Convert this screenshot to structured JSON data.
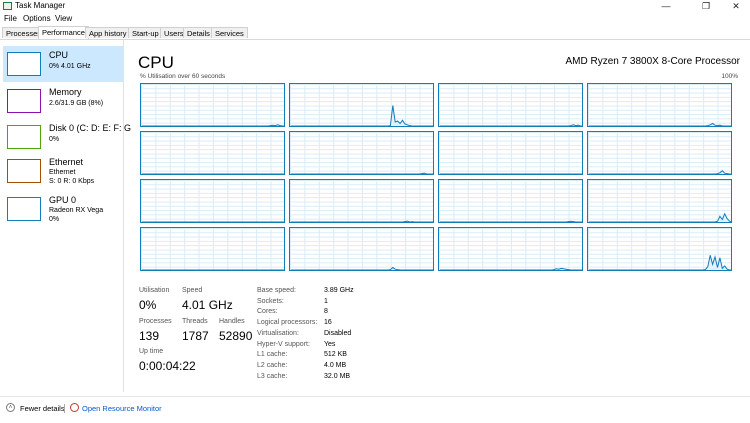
{
  "window": {
    "title": "Task Manager",
    "minimize": "—",
    "restore": "❐",
    "close": "✕"
  },
  "menu": [
    "File",
    "Options",
    "View"
  ],
  "tabs": [
    "Processes",
    "Performance",
    "App history",
    "Start-up",
    "Users",
    "Details",
    "Services"
  ],
  "active_tab": 1,
  "sidebar": [
    {
      "title": "CPU",
      "sub1": "0% 4.01 GHz",
      "sub2": "",
      "color": "#117dbb"
    },
    {
      "title": "Memory",
      "sub1": "2.6/31.9 GB (8%)",
      "sub2": "",
      "color": "#8b12ae"
    },
    {
      "title": "Disk 0 (C: D: E: F: G",
      "sub1": "0%",
      "sub2": "",
      "color": "#4da60c"
    },
    {
      "title": "Ethernet",
      "sub1": "Ethernet",
      "sub2": "S: 0 R: 0 Kbps",
      "color": "#a74f01"
    },
    {
      "title": "GPU 0",
      "sub1": "Radeon RX Vega",
      "sub2": "0%",
      "color": "#117dbb"
    }
  ],
  "main": {
    "title": "CPU",
    "processor": "AMD Ryzen 7 3800X 8-Core Processor",
    "util_label": "% Utilisation over 60 seconds",
    "util_max": "100%",
    "graph_color": "#117dbb"
  },
  "cores": [
    [
      0,
      0,
      0,
      0,
      0,
      0,
      0,
      0,
      0,
      0,
      0,
      0,
      0,
      0,
      0,
      0,
      0,
      0,
      0,
      0,
      0,
      0,
      0,
      0,
      0,
      0,
      0,
      0,
      0,
      0,
      0,
      0,
      0,
      0,
      0,
      0,
      0,
      0,
      0,
      0,
      0,
      0,
      0,
      0,
      0,
      0,
      0,
      0,
      0,
      0,
      0,
      0,
      0,
      1,
      2,
      1,
      3,
      1,
      0,
      0
    ],
    [
      0,
      0,
      0,
      0,
      0,
      0,
      0,
      0,
      0,
      0,
      0,
      0,
      0,
      0,
      0,
      0,
      0,
      0,
      0,
      0,
      0,
      0,
      0,
      0,
      0,
      0,
      0,
      0,
      0,
      0,
      0,
      0,
      0,
      0,
      0,
      0,
      0,
      0,
      0,
      0,
      0,
      1,
      50,
      10,
      12,
      6,
      14,
      5,
      3,
      1,
      0,
      0,
      0,
      0,
      0,
      0,
      0,
      0,
      0,
      0
    ],
    [
      0,
      0,
      0,
      0,
      0,
      0,
      0,
      0,
      0,
      0,
      0,
      0,
      0,
      0,
      0,
      0,
      0,
      0,
      0,
      0,
      0,
      0,
      0,
      0,
      0,
      0,
      0,
      0,
      0,
      0,
      0,
      0,
      0,
      0,
      0,
      0,
      0,
      0,
      0,
      0,
      0,
      0,
      0,
      0,
      0,
      0,
      0,
      0,
      0,
      0,
      0,
      0,
      0,
      0,
      1,
      3,
      1,
      2,
      0,
      0
    ],
    [
      0,
      0,
      0,
      0,
      0,
      0,
      0,
      0,
      0,
      0,
      0,
      0,
      0,
      0,
      0,
      0,
      0,
      0,
      0,
      0,
      0,
      0,
      0,
      0,
      0,
      0,
      0,
      0,
      0,
      0,
      0,
      0,
      0,
      0,
      0,
      0,
      0,
      0,
      0,
      0,
      0,
      0,
      0,
      0,
      0,
      0,
      0,
      0,
      0,
      1,
      3,
      6,
      2,
      1,
      2,
      0,
      0,
      0,
      0,
      0
    ],
    [
      0,
      0,
      0,
      0,
      0,
      0,
      0,
      0,
      0,
      0,
      0,
      0,
      0,
      0,
      0,
      0,
      0,
      0,
      0,
      0,
      0,
      0,
      0,
      0,
      0,
      0,
      0,
      0,
      0,
      0,
      0,
      0,
      0,
      0,
      0,
      0,
      0,
      0,
      0,
      0,
      0,
      0,
      0,
      0,
      0,
      0,
      0,
      0,
      0,
      0,
      0,
      0,
      0,
      0,
      0,
      0,
      0,
      0,
      0,
      0
    ],
    [
      0,
      0,
      0,
      0,
      0,
      0,
      0,
      0,
      0,
      0,
      0,
      0,
      0,
      0,
      0,
      0,
      0,
      0,
      0,
      0,
      0,
      0,
      0,
      0,
      0,
      0,
      0,
      0,
      0,
      0,
      0,
      0,
      0,
      0,
      0,
      0,
      0,
      0,
      0,
      0,
      0,
      0,
      0,
      0,
      0,
      0,
      0,
      0,
      0,
      0,
      0,
      0,
      0,
      0,
      1,
      2,
      0,
      0,
      0,
      0
    ],
    [
      0,
      0,
      0,
      0,
      0,
      0,
      0,
      0,
      0,
      0,
      0,
      0,
      0,
      0,
      0,
      0,
      0,
      0,
      0,
      0,
      0,
      0,
      0,
      0,
      0,
      0,
      0,
      0,
      0,
      0,
      0,
      0,
      0,
      0,
      0,
      0,
      0,
      0,
      0,
      0,
      0,
      0,
      0,
      0,
      0,
      0,
      0,
      0,
      0,
      0,
      0,
      0,
      0,
      0,
      0,
      0,
      0,
      0,
      0,
      0
    ],
    [
      0,
      0,
      0,
      0,
      0,
      0,
      0,
      0,
      0,
      0,
      0,
      0,
      0,
      0,
      0,
      0,
      0,
      0,
      0,
      0,
      0,
      0,
      0,
      0,
      0,
      0,
      0,
      0,
      0,
      0,
      0,
      0,
      0,
      0,
      0,
      0,
      0,
      0,
      0,
      0,
      0,
      0,
      0,
      0,
      0,
      0,
      0,
      0,
      0,
      0,
      0,
      0,
      0,
      1,
      3,
      8,
      2,
      1,
      0,
      0
    ],
    [
      0,
      0,
      0,
      0,
      0,
      0,
      0,
      0,
      0,
      0,
      0,
      0,
      0,
      0,
      0,
      0,
      0,
      0,
      0,
      0,
      0,
      0,
      0,
      0,
      0,
      0,
      0,
      0,
      0,
      0,
      0,
      0,
      0,
      0,
      0,
      0,
      0,
      0,
      0,
      0,
      0,
      0,
      0,
      0,
      0,
      0,
      0,
      0,
      0,
      0,
      0,
      0,
      0,
      0,
      0,
      0,
      0,
      0,
      0,
      0
    ],
    [
      0,
      0,
      0,
      0,
      0,
      0,
      0,
      0,
      0,
      0,
      0,
      0,
      0,
      0,
      0,
      0,
      0,
      0,
      0,
      0,
      0,
      0,
      0,
      0,
      0,
      0,
      0,
      0,
      0,
      0,
      0,
      0,
      0,
      0,
      0,
      0,
      0,
      0,
      0,
      0,
      0,
      0,
      0,
      0,
      0,
      0,
      0,
      1,
      2,
      0,
      1,
      0,
      0,
      0,
      0,
      0,
      0,
      0,
      0,
      0
    ],
    [
      0,
      0,
      0,
      0,
      0,
      0,
      0,
      0,
      0,
      0,
      0,
      0,
      0,
      0,
      0,
      0,
      0,
      0,
      0,
      0,
      0,
      0,
      0,
      0,
      0,
      0,
      0,
      0,
      0,
      0,
      0,
      0,
      0,
      0,
      0,
      0,
      0,
      0,
      0,
      0,
      0,
      0,
      0,
      0,
      0,
      0,
      0,
      0,
      0,
      0,
      0,
      0,
      0,
      1,
      2,
      1,
      0,
      0,
      0,
      0
    ],
    [
      0,
      0,
      0,
      0,
      0,
      0,
      0,
      0,
      0,
      0,
      0,
      0,
      0,
      0,
      0,
      0,
      0,
      0,
      0,
      0,
      0,
      0,
      0,
      0,
      0,
      0,
      0,
      0,
      0,
      0,
      0,
      0,
      0,
      0,
      0,
      0,
      0,
      0,
      0,
      0,
      0,
      0,
      0,
      0,
      0,
      0,
      0,
      0,
      0,
      0,
      0,
      0,
      0,
      2,
      14,
      6,
      20,
      8,
      2,
      0
    ],
    [
      0,
      0,
      0,
      0,
      0,
      0,
      0,
      0,
      0,
      0,
      0,
      0,
      0,
      0,
      0,
      0,
      0,
      0,
      0,
      0,
      0,
      0,
      0,
      0,
      0,
      0,
      0,
      0,
      0,
      0,
      0,
      0,
      0,
      0,
      0,
      0,
      0,
      0,
      0,
      0,
      0,
      0,
      0,
      0,
      0,
      0,
      0,
      0,
      0,
      0,
      0,
      0,
      0,
      0,
      0,
      0,
      0,
      0,
      0,
      0
    ],
    [
      0,
      0,
      0,
      0,
      0,
      0,
      0,
      0,
      0,
      0,
      0,
      0,
      0,
      0,
      0,
      0,
      0,
      0,
      0,
      0,
      0,
      0,
      0,
      0,
      0,
      0,
      0,
      0,
      0,
      0,
      0,
      0,
      0,
      0,
      0,
      0,
      0,
      0,
      0,
      0,
      0,
      1,
      6,
      2,
      1,
      0,
      0,
      0,
      0,
      0,
      0,
      0,
      0,
      0,
      0,
      0,
      0,
      0,
      0,
      0
    ],
    [
      0,
      0,
      0,
      0,
      0,
      0,
      0,
      0,
      0,
      0,
      0,
      0,
      0,
      0,
      0,
      0,
      0,
      0,
      0,
      0,
      0,
      0,
      0,
      0,
      0,
      0,
      0,
      0,
      0,
      0,
      0,
      0,
      0,
      0,
      0,
      0,
      0,
      0,
      0,
      0,
      0,
      0,
      0,
      0,
      0,
      0,
      0,
      1,
      3,
      2,
      4,
      3,
      2,
      1,
      0,
      0,
      0,
      0,
      0,
      0
    ],
    [
      0,
      0,
      0,
      0,
      0,
      0,
      0,
      0,
      0,
      0,
      0,
      0,
      0,
      0,
      0,
      0,
      0,
      0,
      0,
      0,
      0,
      0,
      0,
      0,
      0,
      0,
      0,
      0,
      0,
      0,
      0,
      0,
      0,
      0,
      0,
      0,
      0,
      0,
      0,
      0,
      0,
      0,
      0,
      0,
      0,
      0,
      0,
      0,
      1,
      8,
      36,
      14,
      32,
      6,
      30,
      4,
      10,
      2,
      0,
      0
    ]
  ],
  "stats": {
    "utilisation": {
      "label": "Utilisation",
      "value": "0%"
    },
    "speed": {
      "label": "Speed",
      "value": "4.01 GHz"
    },
    "processes": {
      "label": "Processes",
      "value": "139"
    },
    "threads": {
      "label": "Threads",
      "value": "1787"
    },
    "handles": {
      "label": "Handles",
      "value": "52890"
    },
    "uptime": {
      "label": "Up time",
      "value": "0:00:04:22"
    }
  },
  "specs": [
    {
      "label": "Base speed:",
      "value": "3.89 GHz"
    },
    {
      "label": "Sockets:",
      "value": "1"
    },
    {
      "label": "Cores:",
      "value": "8"
    },
    {
      "label": "Logical processors:",
      "value": "16"
    },
    {
      "label": "Virtualisation:",
      "value": "Disabled"
    },
    {
      "label": "Hyper-V support:",
      "value": "Yes"
    },
    {
      "label": "L1 cache:",
      "value": "512 KB"
    },
    {
      "label": "L2 cache:",
      "value": "4.0 MB"
    },
    {
      "label": "L3 cache:",
      "value": "32.0 MB"
    }
  ],
  "footer": {
    "fewer_details": "Fewer details",
    "open_resource_monitor": "Open Resource Monitor",
    "chevron": "˄"
  }
}
